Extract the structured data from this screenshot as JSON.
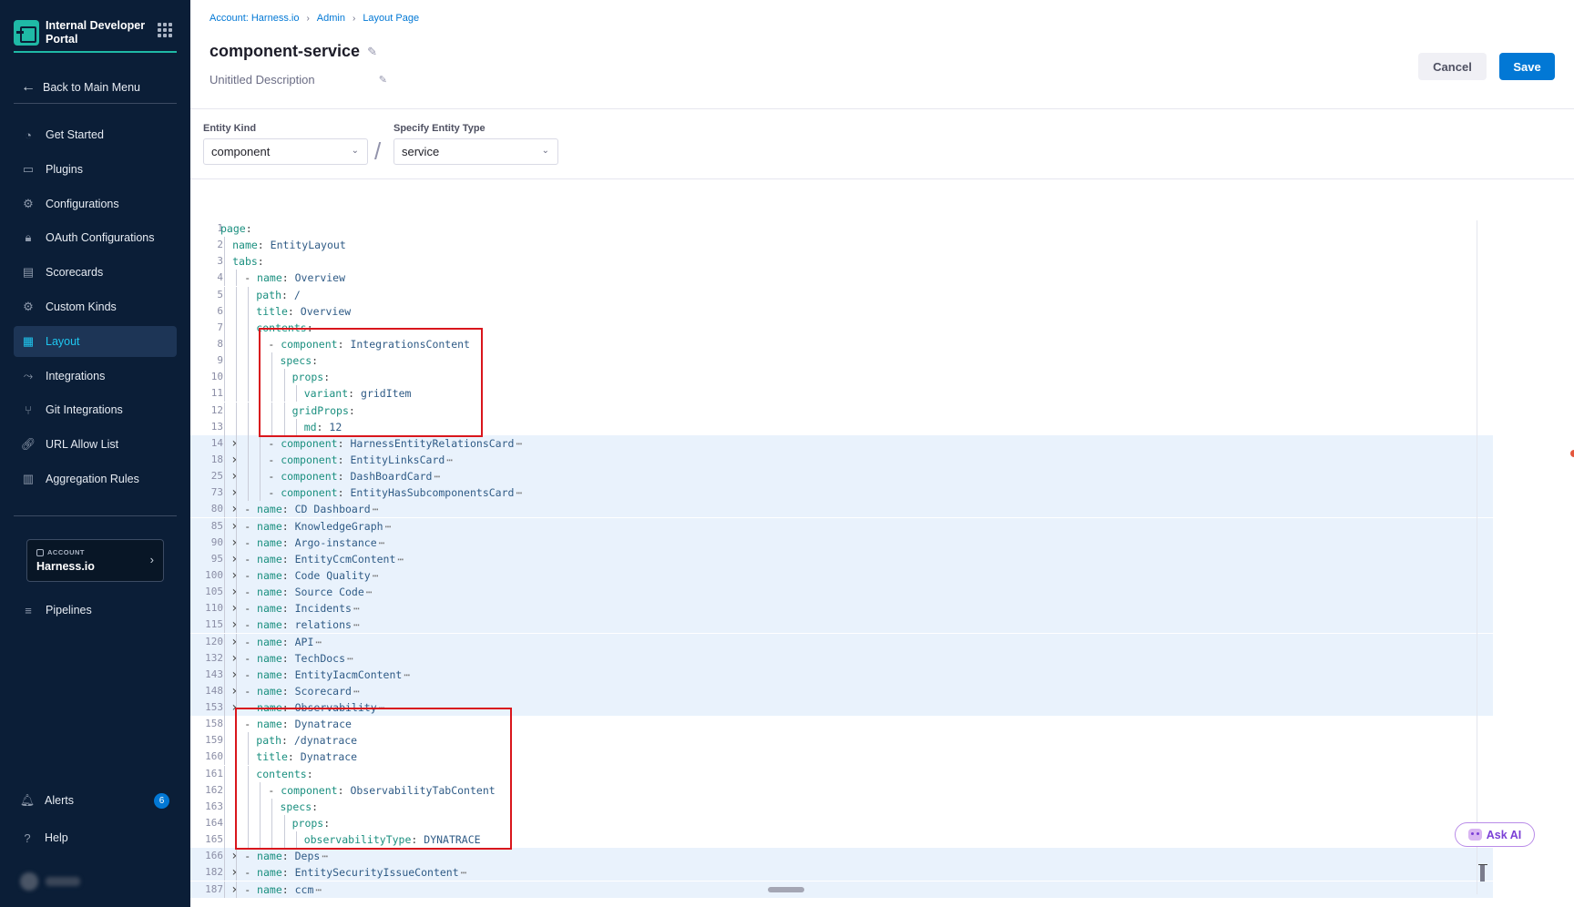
{
  "sidebar": {
    "brand": "Internal Developer Portal",
    "back": "Back to Main Menu",
    "items": [
      {
        "label": "Get Started",
        "icon": "rocket-icon"
      },
      {
        "label": "Plugins",
        "icon": "plugin-icon"
      },
      {
        "label": "Configurations",
        "icon": "gears-icon"
      },
      {
        "label": "OAuth Configurations",
        "icon": "lock-icon"
      },
      {
        "label": "Scorecards",
        "icon": "scorecard-icon"
      },
      {
        "label": "Custom Kinds",
        "icon": "gear-icon"
      },
      {
        "label": "Layout",
        "icon": "layout-icon",
        "active": true
      },
      {
        "label": "Integrations",
        "icon": "integration-icon"
      },
      {
        "label": "Git Integrations",
        "icon": "git-icon"
      },
      {
        "label": "URL Allow List",
        "icon": "link-icon"
      },
      {
        "label": "Aggregation Rules",
        "icon": "chart-icon"
      }
    ],
    "account_label": "ACCOUNT",
    "account_name": "Harness.io",
    "pipelines": "Pipelines",
    "alerts": "Alerts",
    "alerts_count": "6",
    "help": "Help",
    "accent": "#1fb9a6"
  },
  "breadcrumb": [
    "Account: Harness.io",
    "Admin",
    "Layout Page"
  ],
  "page": {
    "title": "component-service",
    "description": "Unititled Description",
    "cancel": "Cancel",
    "save": "Save",
    "entity_kind_label": "Entity Kind",
    "entity_kind_value": "component",
    "entity_type_label": "Specify Entity Type",
    "entity_type_value": "service",
    "ask_ai": "Ask AI"
  },
  "editor": {
    "lines": [
      {
        "n": "1",
        "indent": 0,
        "dash": false,
        "key": "page",
        "val": "",
        "folded": false
      },
      {
        "n": "2",
        "indent": 1,
        "dash": false,
        "key": "name",
        "val": "EntityLayout",
        "folded": false
      },
      {
        "n": "3",
        "indent": 1,
        "dash": false,
        "key": "tabs",
        "val": "",
        "folded": false
      },
      {
        "n": "4",
        "indent": 2,
        "dash": true,
        "key": "name",
        "val": "Overview",
        "folded": false
      },
      {
        "n": "5",
        "indent": 3,
        "dash": false,
        "key": "path",
        "val": "/",
        "folded": false
      },
      {
        "n": "6",
        "indent": 3,
        "dash": false,
        "key": "title",
        "val": "Overview",
        "folded": false
      },
      {
        "n": "7",
        "indent": 3,
        "dash": false,
        "key": "contents",
        "val": "",
        "folded": false
      },
      {
        "n": "8",
        "indent": 4,
        "dash": true,
        "key": "component",
        "val": "IntegrationsContent",
        "folded": false
      },
      {
        "n": "9",
        "indent": 5,
        "dash": false,
        "key": "specs",
        "val": "",
        "folded": false
      },
      {
        "n": "10",
        "indent": 6,
        "dash": false,
        "key": "props",
        "val": "",
        "folded": false
      },
      {
        "n": "11",
        "indent": 7,
        "dash": false,
        "key": "variant",
        "val": "gridItem",
        "folded": false
      },
      {
        "n": "12",
        "indent": 6,
        "dash": false,
        "key": "gridProps",
        "val": "",
        "folded": false
      },
      {
        "n": "13",
        "indent": 7,
        "dash": false,
        "key": "md",
        "val": "12",
        "folded": false
      },
      {
        "n": "14",
        "indent": 4,
        "dash": true,
        "key": "component",
        "val": "HarnessEntityRelationsCard",
        "folded": true
      },
      {
        "n": "18",
        "indent": 4,
        "dash": true,
        "key": "component",
        "val": "EntityLinksCard",
        "folded": true
      },
      {
        "n": "25",
        "indent": 4,
        "dash": true,
        "key": "component",
        "val": "DashBoardCard",
        "folded": true
      },
      {
        "n": "73",
        "indent": 4,
        "dash": true,
        "key": "component",
        "val": "EntityHasSubcomponentsCard",
        "folded": true
      },
      {
        "n": "80",
        "indent": 2,
        "dash": true,
        "key": "name",
        "val": "CD Dashboard",
        "folded": true
      },
      {
        "n": "85",
        "indent": 2,
        "dash": true,
        "key": "name",
        "val": "KnowledgeGraph",
        "folded": true
      },
      {
        "n": "90",
        "indent": 2,
        "dash": true,
        "key": "name",
        "val": "Argo-instance",
        "folded": true
      },
      {
        "n": "95",
        "indent": 2,
        "dash": true,
        "key": "name",
        "val": "EntityCcmContent",
        "folded": true
      },
      {
        "n": "100",
        "indent": 2,
        "dash": true,
        "key": "name",
        "val": "Code Quality",
        "folded": true
      },
      {
        "n": "105",
        "indent": 2,
        "dash": true,
        "key": "name",
        "val": "Source Code",
        "folded": true
      },
      {
        "n": "110",
        "indent": 2,
        "dash": true,
        "key": "name",
        "val": "Incidents",
        "folded": true
      },
      {
        "n": "115",
        "indent": 2,
        "dash": true,
        "key": "name",
        "val": "relations",
        "folded": true
      },
      {
        "n": "120",
        "indent": 2,
        "dash": true,
        "key": "name",
        "val": "API",
        "folded": true
      },
      {
        "n": "132",
        "indent": 2,
        "dash": true,
        "key": "name",
        "val": "TechDocs",
        "folded": true
      },
      {
        "n": "143",
        "indent": 2,
        "dash": true,
        "key": "name",
        "val": "EntityIacmContent",
        "folded": true
      },
      {
        "n": "148",
        "indent": 2,
        "dash": true,
        "key": "name",
        "val": "Scorecard",
        "folded": true
      },
      {
        "n": "153",
        "indent": 2,
        "dash": true,
        "key": "name",
        "val": "Observability",
        "folded": true
      },
      {
        "n": "158",
        "indent": 2,
        "dash": true,
        "key": "name",
        "val": "Dynatrace",
        "folded": false
      },
      {
        "n": "159",
        "indent": 3,
        "dash": false,
        "key": "path",
        "val": "/dynatrace",
        "folded": false
      },
      {
        "n": "160",
        "indent": 3,
        "dash": false,
        "key": "title",
        "val": "Dynatrace",
        "folded": false
      },
      {
        "n": "161",
        "indent": 3,
        "dash": false,
        "key": "contents",
        "val": "",
        "folded": false
      },
      {
        "n": "162",
        "indent": 4,
        "dash": true,
        "key": "component",
        "val": "ObservabilityTabContent",
        "folded": false
      },
      {
        "n": "163",
        "indent": 5,
        "dash": false,
        "key": "specs",
        "val": "",
        "folded": false
      },
      {
        "n": "164",
        "indent": 6,
        "dash": false,
        "key": "props",
        "val": "",
        "folded": false
      },
      {
        "n": "165",
        "indent": 7,
        "dash": false,
        "key": "observabilityType",
        "val": "DYNATRACE",
        "folded": false
      },
      {
        "n": "166",
        "indent": 2,
        "dash": true,
        "key": "name",
        "val": "Deps",
        "folded": true
      },
      {
        "n": "182",
        "indent": 2,
        "dash": true,
        "key": "name",
        "val": "EntitySecurityIssueContent",
        "folded": true
      },
      {
        "n": "187",
        "indent": 2,
        "dash": true,
        "key": "name",
        "val": "ccm",
        "folded": true
      }
    ]
  }
}
